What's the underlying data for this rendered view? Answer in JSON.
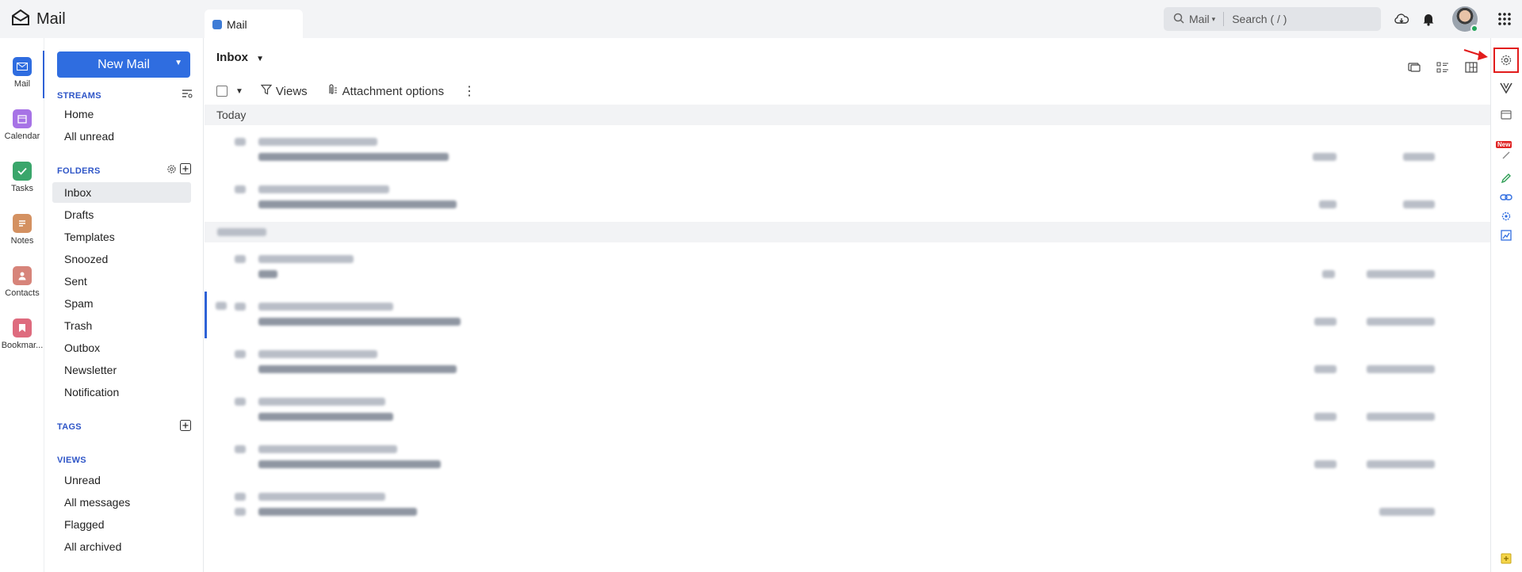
{
  "brand": {
    "title": "Mail",
    "icon": "mail-envelope-icon"
  },
  "tab": {
    "label": "Mail"
  },
  "search": {
    "scope": "Mail",
    "placeholder": "Search ( / )"
  },
  "topbar_icons": [
    "cloud-icon",
    "bell-icon",
    "apps-grid-icon"
  ],
  "colors": {
    "accent": "#2f6de0",
    "selected_bg": "#e9ebee",
    "highlight": "#e21c1c",
    "online": "#23a55a"
  },
  "rail": [
    {
      "label": "Mail",
      "icon": "mail-icon",
      "color": "#2f6de0"
    },
    {
      "label": "Calendar",
      "icon": "calendar-icon",
      "color": "#a773e6"
    },
    {
      "label": "Tasks",
      "icon": "tasks-check-icon",
      "color": "#3aa66b"
    },
    {
      "label": "Notes",
      "icon": "notes-icon",
      "color": "#d49161"
    },
    {
      "label": "Contacts",
      "icon": "contacts-icon",
      "color": "#d7847a"
    },
    {
      "label": "Bookmar...",
      "icon": "bookmark-icon",
      "color": "#de6b7e"
    }
  ],
  "new_mail": {
    "label": "New Mail"
  },
  "streams": {
    "title": "STREAMS",
    "items": [
      "Home",
      "All unread"
    ]
  },
  "folders": {
    "title": "FOLDERS",
    "items": [
      "Inbox",
      "Drafts",
      "Templates",
      "Snoozed",
      "Sent",
      "Spam",
      "Trash",
      "Outbox",
      "Newsletter",
      "Notification"
    ],
    "selected": "Inbox"
  },
  "tags": {
    "title": "TAGS"
  },
  "views": {
    "title": "VIEWS",
    "items": [
      "Unread",
      "All messages",
      "Flagged",
      "All archived"
    ]
  },
  "inbox": {
    "title": "Inbox"
  },
  "toolbar": {
    "views": "Views",
    "attachment": "Attachment options"
  },
  "groups": {
    "today": "Today"
  },
  "right_rail_icons": [
    "settings-gear-icon",
    "vault-icon",
    "window-icon",
    "new-feature-icon",
    "pen-icon",
    "link-icon",
    "puzzle-icon",
    "chart-icon",
    "sticky-note-icon"
  ],
  "right_rail_new": "New"
}
